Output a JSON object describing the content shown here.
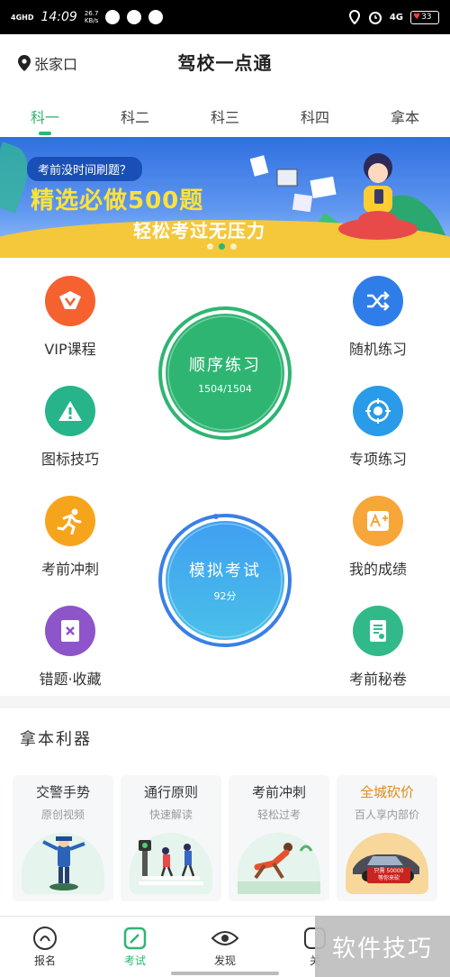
{
  "status_bar": {
    "network": "4GHD",
    "time": "14:09",
    "speed": "26.7\nKB/s",
    "signal_label": "4G",
    "battery": "33"
  },
  "header": {
    "location": "张家口",
    "title": "驾校一点通"
  },
  "tabs": [
    {
      "label": "科一",
      "active": true
    },
    {
      "label": "科二",
      "active": false
    },
    {
      "label": "科三",
      "active": false
    },
    {
      "label": "科四",
      "active": false
    },
    {
      "label": "拿本",
      "active": false
    }
  ],
  "banner": {
    "question": "考前没时间刷题？",
    "headline": "精选必做500题",
    "subline": "轻松考过无压力",
    "dots": 3,
    "active_dot": 1
  },
  "features": {
    "vip": "VIP课程",
    "random": "随机练习",
    "signs": "图标技巧",
    "special": "专项练习",
    "sprint": "考前冲刺",
    "scores": "我的成绩",
    "mistakes": "错题·收藏",
    "secret": "考前秘卷"
  },
  "sequential": {
    "title": "顺序练习",
    "progress": "1504/1504",
    "progress_fraction": 1.0
  },
  "mock_exam": {
    "title": "模拟考试",
    "score": "92分"
  },
  "tools": {
    "title": "拿本利器",
    "cards": [
      {
        "title": "交警手势",
        "subtitle": "原创视频",
        "highlight": false
      },
      {
        "title": "通行原则",
        "subtitle": "快速解读",
        "highlight": false
      },
      {
        "title": "考前冲刺",
        "subtitle": "轻松过考",
        "highlight": false
      },
      {
        "title": "全城砍价",
        "subtitle": "百人享内部价",
        "highlight": true
      }
    ],
    "car_badge_line1": "只需 50000",
    "car_badge_line2": "等你来砍"
  },
  "bottom_nav": [
    {
      "label": "报名",
      "active": false
    },
    {
      "label": "考试",
      "active": true
    },
    {
      "label": "发现",
      "active": false
    },
    {
      "label": "关",
      "active": false
    }
  ],
  "watermark": "软件技巧",
  "colors": {
    "accent": "#2eb572",
    "banner_blue": "#2f6fe0",
    "headline_yellow": "#ffe23a"
  }
}
